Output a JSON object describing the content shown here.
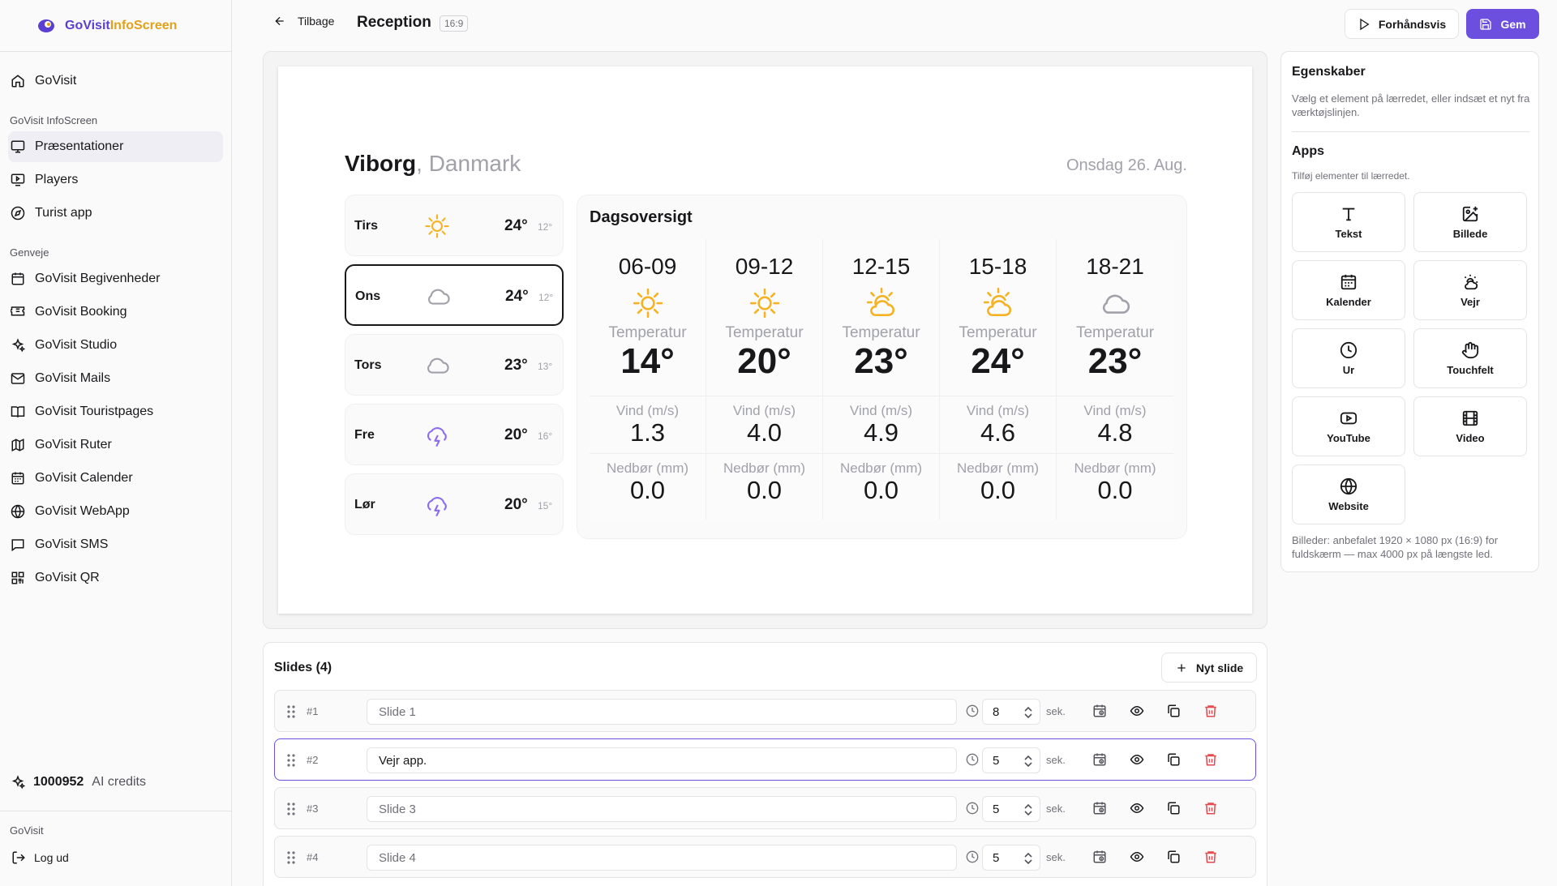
{
  "app": {
    "logo_part1": "GoVisit",
    "logo_part2": "InfoScreen"
  },
  "sidebar": {
    "home_label": "GoVisit",
    "group1_title": "GoVisit InfoScreen",
    "group1_items": [
      {
        "label": "Præsentationer",
        "icon": "monitor-icon"
      },
      {
        "label": "Players",
        "icon": "player-icon"
      },
      {
        "label": "Turist app",
        "icon": "compass-icon"
      }
    ],
    "group2_title": "Genveje",
    "group2_items": [
      {
        "label": "GoVisit Begivenheder",
        "icon": "calendar-icon"
      },
      {
        "label": "GoVisit Booking",
        "icon": "ticket-icon"
      },
      {
        "label": "GoVisit Studio",
        "icon": "sparkles-icon"
      },
      {
        "label": "GoVisit Mails",
        "icon": "mail-icon"
      },
      {
        "label": "GoVisit Touristpages",
        "icon": "book-icon"
      },
      {
        "label": "GoVisit Ruter",
        "icon": "map-icon"
      },
      {
        "label": "GoVisit Calender",
        "icon": "calendar-days-icon"
      },
      {
        "label": "GoVisit WebApp",
        "icon": "globe-icon"
      },
      {
        "label": "GoVisit SMS",
        "icon": "message-icon"
      },
      {
        "label": "GoVisit QR",
        "icon": "qr-icon"
      }
    ],
    "credits_value": "1000952",
    "credits_label": "AI credits",
    "footer_title": "GoVisit",
    "logout_label": "Log ud"
  },
  "header": {
    "back_label": "Tilbage",
    "title": "Reception",
    "ratio": "16:9",
    "preview_label": "Forhåndsvis",
    "save_label": "Gem"
  },
  "weather": {
    "city": "Viborg",
    "country": ", Danmark",
    "date": "Onsdag 26. Aug.",
    "days": [
      {
        "name": "Tirs",
        "icon": "sun",
        "high": "24°",
        "low": "12°"
      },
      {
        "name": "Ons",
        "icon": "cloud",
        "high": "24°",
        "low": "12°"
      },
      {
        "name": "Tors",
        "icon": "cloud",
        "high": "23°",
        "low": "13°"
      },
      {
        "name": "Fre",
        "icon": "storm",
        "high": "20°",
        "low": "16°"
      },
      {
        "name": "Lør",
        "icon": "storm",
        "high": "20°",
        "low": "15°"
      }
    ],
    "overview_title": "Dagsoversigt",
    "temp_label": "Temperatur",
    "wind_label": "Vind (m/s)",
    "rain_label": "Nedbør (mm)",
    "periods": [
      {
        "time": "06-09",
        "icon": "sun",
        "temp": "14°",
        "wind": "1.3",
        "rain": "0.0"
      },
      {
        "time": "09-12",
        "icon": "sun",
        "temp": "20°",
        "wind": "4.0",
        "rain": "0.0"
      },
      {
        "time": "12-15",
        "icon": "partly-cloudy",
        "temp": "23°",
        "wind": "4.9",
        "rain": "0.0"
      },
      {
        "time": "15-18",
        "icon": "partly-cloudy",
        "temp": "24°",
        "wind": "4.6",
        "rain": "0.0"
      },
      {
        "time": "18-21",
        "icon": "cloud",
        "temp": "23°",
        "wind": "4.8",
        "rain": "0.0"
      }
    ]
  },
  "properties": {
    "title": "Egenskaber",
    "desc": "Vælg et element på lærredet, eller indsæt et nyt fra værktøjslinjen.",
    "apps_title": "Apps",
    "apps_desc": "Tilføj elementer til lærredet.",
    "apps": [
      "Tekst",
      "Billede",
      "Kalender",
      "Vejr",
      "Ur",
      "Touchfelt",
      "YouTube",
      "Video",
      "Website"
    ],
    "note": "Billeder: anbefalet 1920 × 1080 px (16:9) for fuldskærm — max 4000 px på længste led."
  },
  "slides": {
    "title": "Slides (4)",
    "new_label": "Nyt slide",
    "sec_label": "sek.",
    "rows": [
      {
        "index": "#1",
        "name": "Slide 1",
        "duration": "8"
      },
      {
        "index": "#2",
        "name": "Vejr app.",
        "duration": "5"
      },
      {
        "index": "#3",
        "name": "Slide 3",
        "duration": "5"
      },
      {
        "index": "#4",
        "name": "Slide 4",
        "duration": "5"
      }
    ]
  },
  "colors": {
    "accent": "#6d4fe0",
    "sun": "#f5b324",
    "cloud": "#a1a1aa",
    "storm": "#8b6cf0",
    "danger": "#e5484d"
  }
}
